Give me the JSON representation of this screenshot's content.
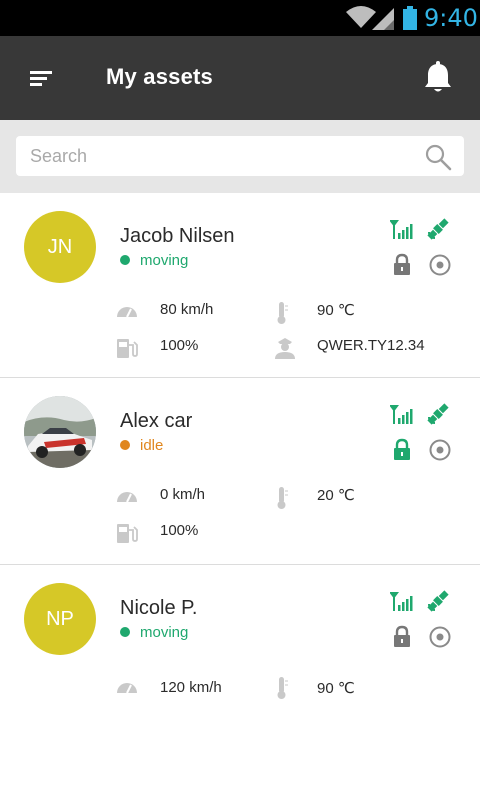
{
  "status_bar": {
    "time": "9:40"
  },
  "app_bar": {
    "title": "My assets"
  },
  "search": {
    "placeholder": "Search"
  },
  "assets": [
    {
      "initials": "JN",
      "name": "Jacob Nilsen",
      "status": "moving",
      "speed": "80 km/h",
      "temperature": "90 ℃",
      "fuel": "100%",
      "driver_id": "QWER.TY12.34",
      "locked": true
    },
    {
      "initials": "",
      "name": "Alex car",
      "status": "idle",
      "speed": "0 km/h",
      "temperature": "20 ℃",
      "fuel": "100%",
      "locked": true
    },
    {
      "initials": "NP",
      "name": "Nicole P.",
      "status": "moving",
      "speed": "120 km/h",
      "temperature": "90 ℃",
      "locked": true
    }
  ],
  "colors": {
    "app_bar": "#383838",
    "accent_green": "#1fa86e",
    "idle_orange": "#e0861e",
    "avatar_yellow": "#d6c827",
    "status_time_blue": "#33b5e5"
  },
  "icons": [
    "wifi-icon",
    "cell-signal-icon",
    "battery-icon",
    "menu-icon",
    "bell-icon",
    "search-icon",
    "gsm-signal-icon",
    "satellite-icon",
    "lock-icon",
    "target-icon",
    "speedometer-icon",
    "thermometer-icon",
    "fuel-icon",
    "driver-icon"
  ]
}
